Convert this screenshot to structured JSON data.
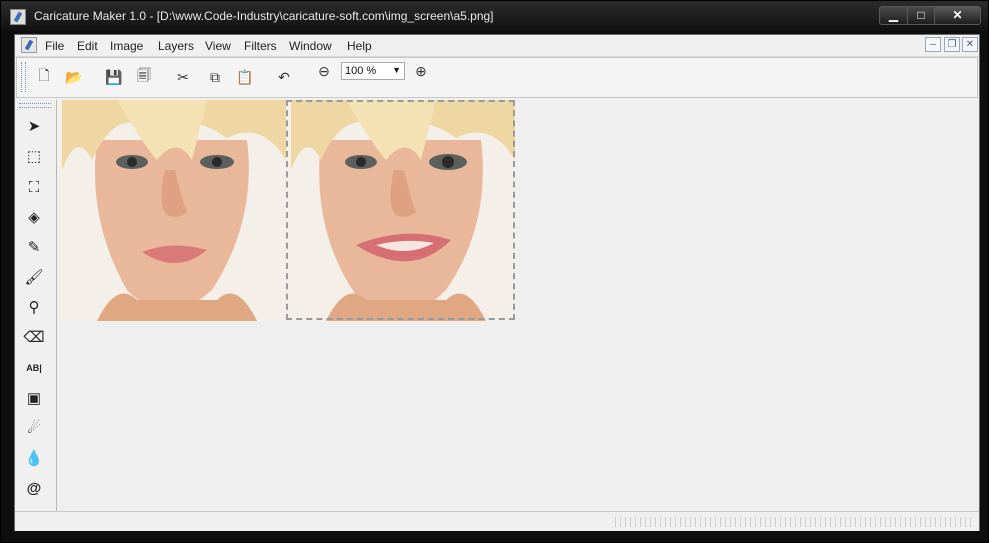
{
  "window": {
    "title": "Caricature Maker 1.0 - [D:\\www.Code-Industry\\caricature-soft.com\\img_screen\\a5.png]",
    "controls": {
      "minimize": "▁",
      "maximize": "□",
      "close": "✕"
    }
  },
  "menubar": {
    "items": [
      "File",
      "Edit",
      "Image",
      "Layers",
      "View",
      "Filters",
      "Window",
      "Help"
    ],
    "mdi_controls": {
      "minimize": "–",
      "restore": "❐",
      "close": "✕"
    }
  },
  "toolbar": {
    "buttons": [
      {
        "name": "new-icon",
        "glyph": "🗋"
      },
      {
        "name": "open-icon",
        "glyph": "📂"
      },
      {
        "name": "save-icon",
        "glyph": "💾"
      },
      {
        "name": "save-all-icon",
        "glyph": "🗐"
      },
      {
        "name": "cut-icon",
        "glyph": "✂"
      },
      {
        "name": "copy-icon",
        "glyph": "⧉"
      },
      {
        "name": "paste-icon",
        "glyph": "📋"
      },
      {
        "name": "undo-icon",
        "glyph": "↶"
      },
      {
        "name": "zoom-out-icon",
        "glyph": "⊖"
      },
      {
        "name": "zoom-in-icon",
        "glyph": "⊕"
      }
    ],
    "zoom": {
      "value": "100 %",
      "arrow": "▼"
    }
  },
  "tools": [
    {
      "name": "move-tool-icon",
      "glyph": "➤"
    },
    {
      "name": "rect-select-tool-icon",
      "glyph": "⬚"
    },
    {
      "name": "crop-tool-icon",
      "glyph": "⛶"
    },
    {
      "name": "fill-tool-icon",
      "glyph": "◈"
    },
    {
      "name": "pencil-tool-icon",
      "glyph": "✎"
    },
    {
      "name": "brush-tool-icon",
      "glyph": "🖌"
    },
    {
      "name": "eyedropper-tool-icon",
      "glyph": "⚲"
    },
    {
      "name": "eraser-tool-icon",
      "glyph": "⌫"
    },
    {
      "name": "text-tool-icon",
      "glyph": "AB|"
    },
    {
      "name": "image-tool-icon",
      "glyph": "▣"
    },
    {
      "name": "smudge-tool-icon",
      "glyph": "☄"
    },
    {
      "name": "drop-tool-icon",
      "glyph": "💧"
    },
    {
      "name": "twirl-tool-icon",
      "glyph": "@"
    }
  ]
}
